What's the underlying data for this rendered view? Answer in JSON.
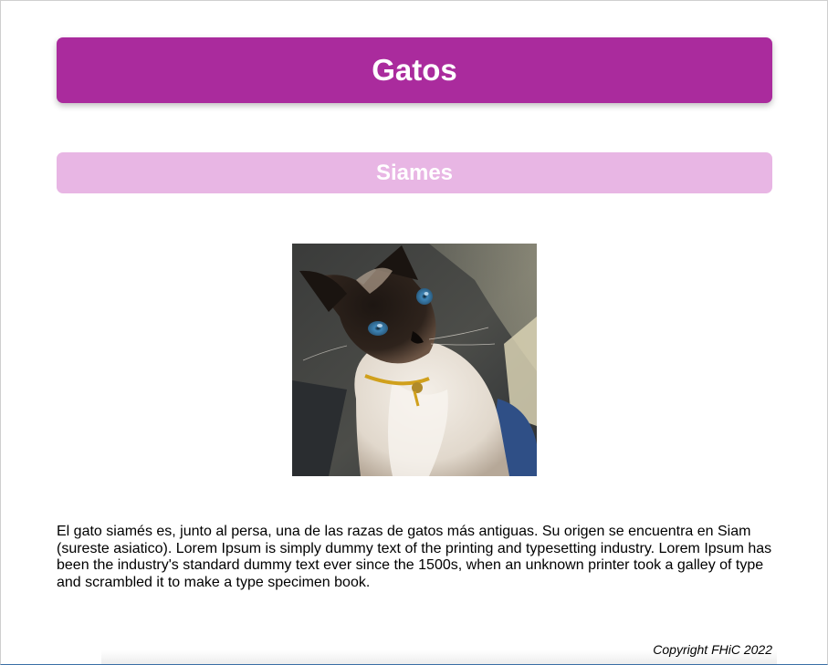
{
  "header": {
    "title": "Gatos"
  },
  "section": {
    "subtitle": "Siames"
  },
  "content": {
    "image_alt": "Gato siamés",
    "description": "El gato siamés es, junto al persa, una de las razas de gatos más antiguas. Su origen se encuentra en Siam (sureste asiatico). Lorem Ipsum is simply dummy text of the printing and typesetting industry. Lorem Ipsum has been the industry's standard dummy text ever since the 1500s, when an unknown printer took a galley of type and scrambled it to make a type specimen book."
  },
  "footer": {
    "copyright": "Copyright FHiC 2022"
  },
  "colors": {
    "title_background": "#aa2b9d",
    "subtitle_background": "#e8b6e4",
    "heading_text": "#ffffff"
  }
}
